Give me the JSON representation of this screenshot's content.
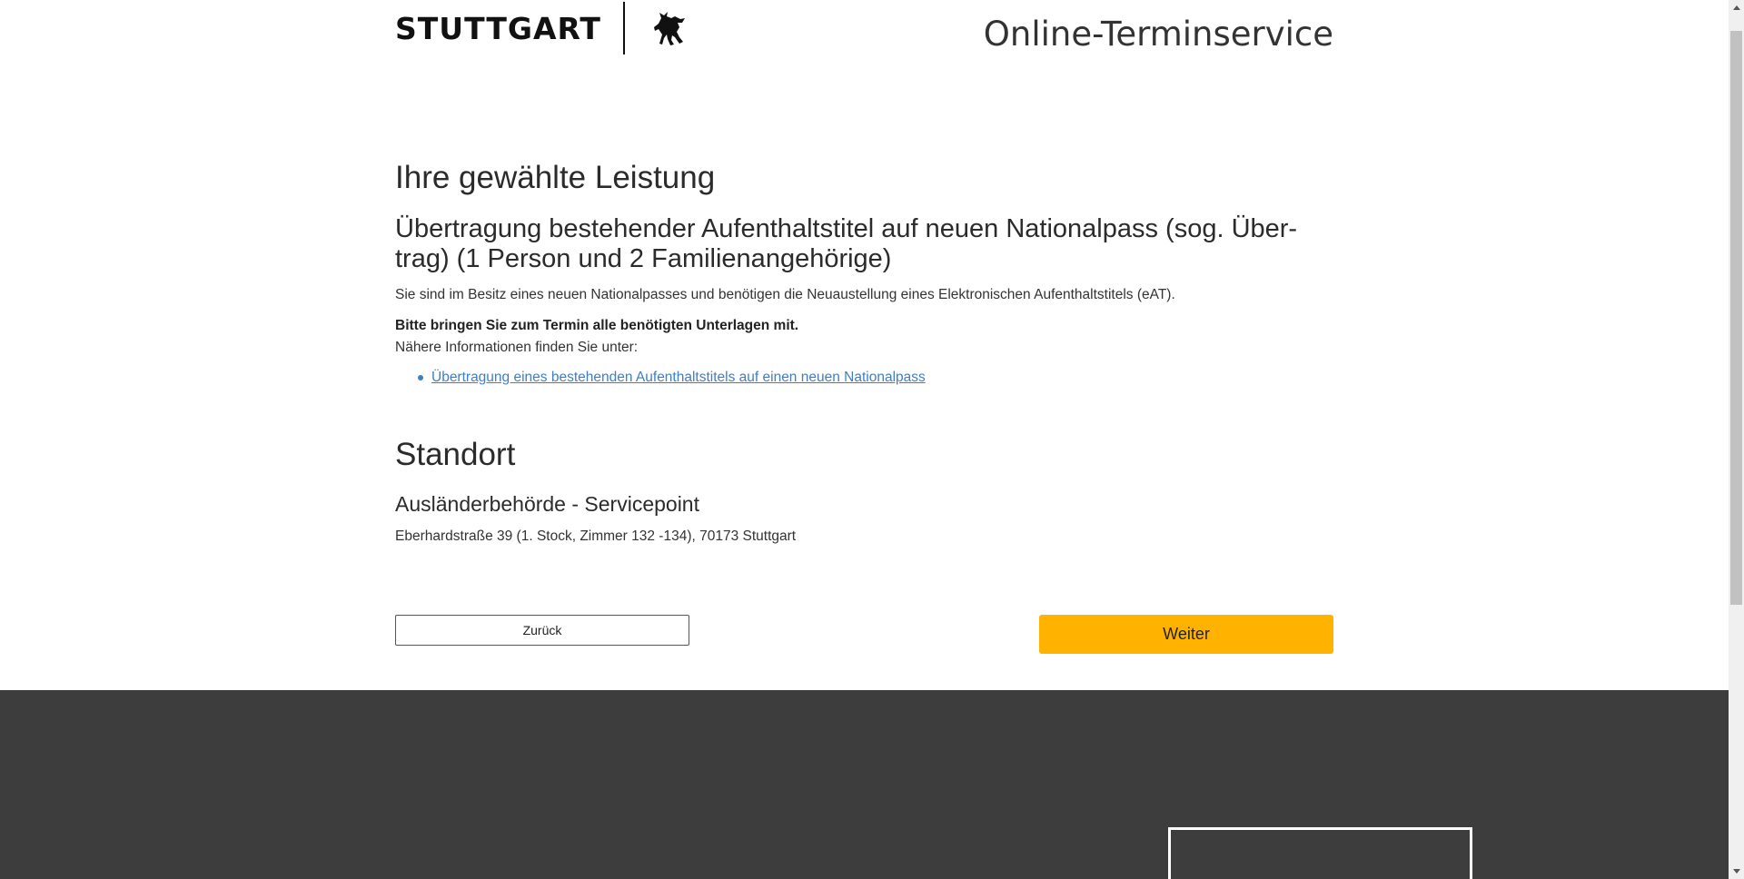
{
  "header": {
    "logo_text": "STUTTGART",
    "logo_icon": "stuttgart-horse-icon",
    "site_title": "Online-Terminservice"
  },
  "service": {
    "heading": "Ihre gewählte Leistung",
    "title": "Übertragung bestehender Aufenthaltstitel auf neuen Nationalpass (sog. Über-trag) (1 Person und 2 Familienangehörige)",
    "description": "Sie sind im Besitz eines neuen Nationalpasses und benötigen die Neuaustellung eines Elektronischen Aufenthaltstitels (eAT).",
    "notice": "Bitte bringen Sie zum Termin alle benötigten Unterlagen mit.",
    "info_text": "Nähere Informationen finden Sie unter:",
    "links": [
      "Übertragung eines bestehenden Aufenthaltstitels auf einen neuen Nationalpass"
    ]
  },
  "location": {
    "heading": "Standort",
    "name": "Ausländerbehörde - Servicepoint",
    "address": "Eberhardstraße 39 (1. Stock, Zimmer 132 -134), 70173 Stuttgart"
  },
  "buttons": {
    "back_label": "Zurück",
    "next_label": "Weiter"
  },
  "colors": {
    "accent": "#ffb300",
    "link": "#3f7fc4",
    "footer": "#3d3d3d"
  }
}
